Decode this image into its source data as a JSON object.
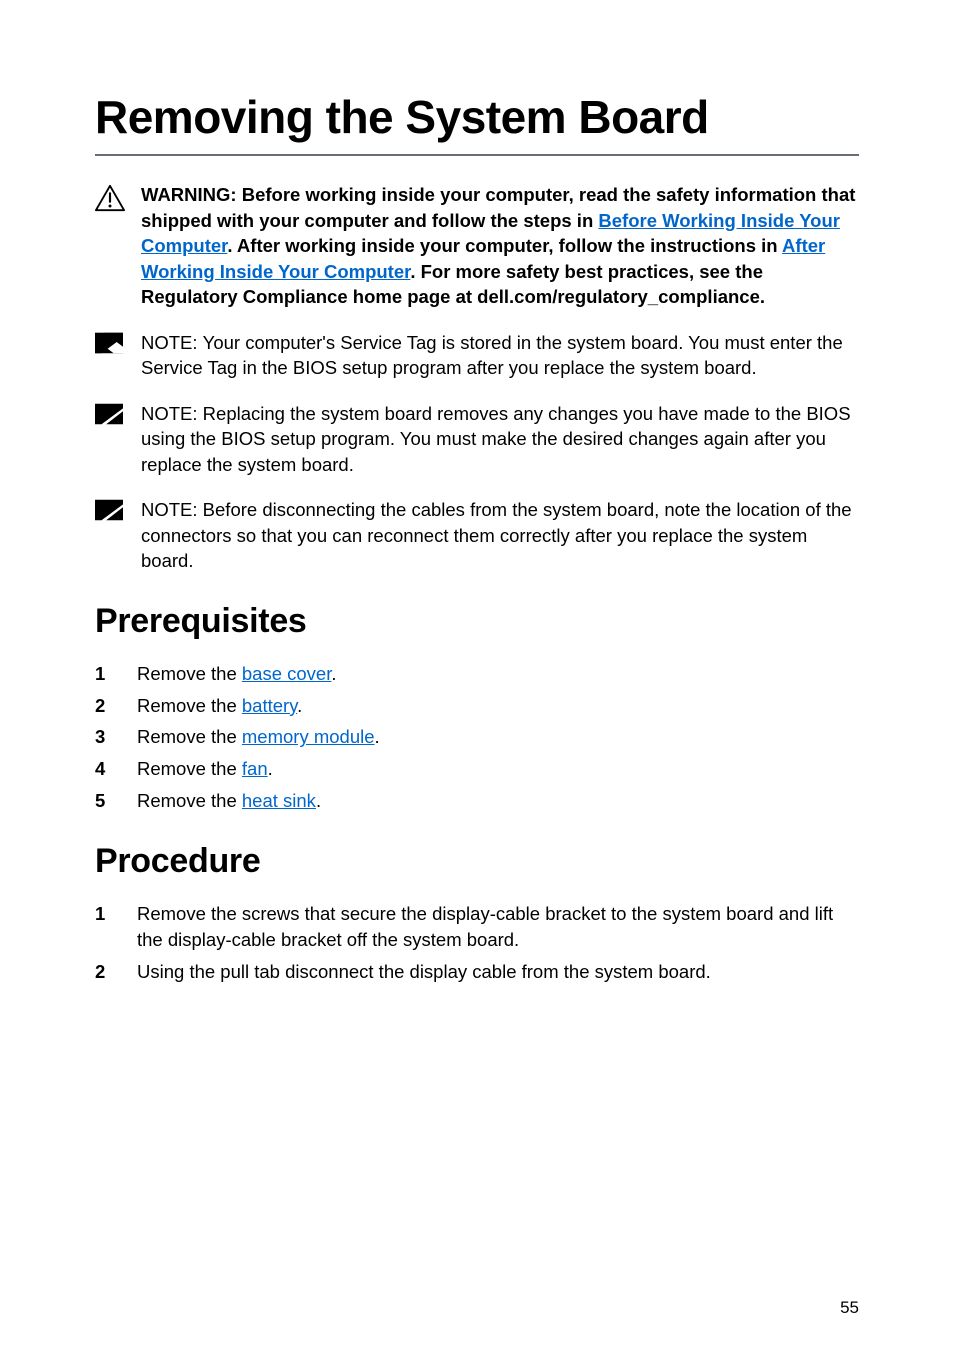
{
  "title": "Removing the System Board",
  "warning": {
    "pre_link1": "WARNING: Before working inside your computer, read the safety information that shipped with your computer and follow the steps in ",
    "link1": "Before Working Inside Your Computer",
    "mid": ". After working inside your computer, follow the instructions in ",
    "link2": "After Working Inside Your Computer",
    "post": ". For more safety best practices, see the Regulatory Compliance home page at dell.com/regulatory_compliance."
  },
  "notes": [
    {
      "lead": "NOTE: ",
      "body": "Your computer's Service Tag is stored in the system board. You must enter the Service Tag in the BIOS setup program after you replace the system board."
    },
    {
      "lead": "NOTE: ",
      "body": "Replacing the system board removes any changes you have made to the BIOS using the BIOS setup program. You must make the desired changes again after you replace the system board."
    },
    {
      "lead": "NOTE: ",
      "body": "Before disconnecting the cables from the system board, note the location of the connectors so that you can reconnect them correctly after you replace the system board."
    }
  ],
  "sections": {
    "prereq_heading": "Prerequisites",
    "procedure_heading": "Procedure"
  },
  "prereqs": [
    {
      "num": "1",
      "pre": "Remove the ",
      "link": "base cover",
      "post": "."
    },
    {
      "num": "2",
      "pre": "Remove the ",
      "link": "battery",
      "post": "."
    },
    {
      "num": "3",
      "pre": "Remove the ",
      "link": "memory module",
      "post": "."
    },
    {
      "num": "4",
      "pre": "Remove the ",
      "link": "fan",
      "post": "."
    },
    {
      "num": "5",
      "pre": "Remove the ",
      "link": "heat sink",
      "post": "."
    }
  ],
  "procedure": [
    {
      "num": "1",
      "text": "Remove the screws that secure the display-cable bracket to the system board and lift the display-cable bracket off the system board."
    },
    {
      "num": "2",
      "text": "Using the pull tab disconnect the display cable from the system board."
    }
  ],
  "page_number": "55"
}
